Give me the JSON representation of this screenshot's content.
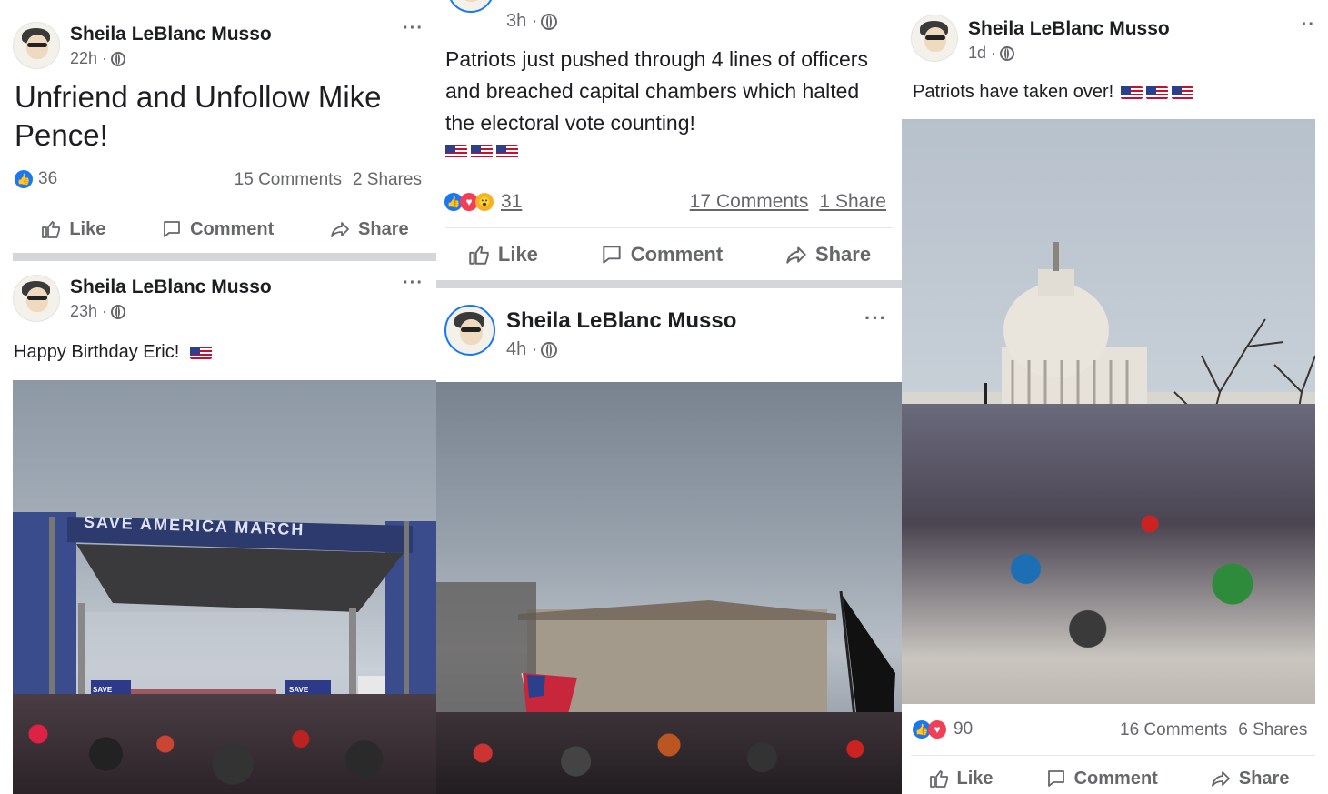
{
  "colors": {
    "accent": "#1877f2",
    "secondary_text": "#65676b",
    "separator": "#d4d6da",
    "love": "#f33e58",
    "wow": "#f7b125"
  },
  "icons": [
    "avatar",
    "globe-icon",
    "more-icon",
    "like-reaction-icon",
    "love-reaction-icon",
    "wow-reaction-icon",
    "thumbs-up-icon",
    "comment-icon",
    "share-icon",
    "us-flag-emoji"
  ],
  "post1": {
    "author": "Sheila LeBlanc Musso",
    "time": "22h ·",
    "more": "···",
    "text": "Unfriend and Unfollow Mike Pence!",
    "reaction_count": "36",
    "comments": "15 Comments",
    "shares": "2 Shares",
    "actions": {
      "like": "Like",
      "comment": "Comment",
      "share": "Share"
    }
  },
  "post2": {
    "author": "Sheila LeBlanc Musso",
    "time": "23h ·",
    "more": "···",
    "text": "Happy Birthday Eric!",
    "image_banner": "SAVE AMERICA MARCH",
    "sign_left": "SAVE AMERICA",
    "sign_right": "SAVE AMERICA MARCH"
  },
  "post3": {
    "time": "3h ·",
    "text": "Patriots just pushed through 4 lines of officers and breached capital chambers which halted the electoral vote counting!",
    "reaction_count": "31",
    "comments": "17 Comments",
    "shares": "1 Share",
    "actions": {
      "like": "Like",
      "comment": "Comment",
      "share": "Share"
    }
  },
  "post4": {
    "author": "Sheila LeBlanc Musso",
    "time": "4h ·",
    "more": "···"
  },
  "post5": {
    "author": "Sheila LeBlanc Musso",
    "time": "1d ·",
    "more": "··",
    "text": "Patriots have taken over!",
    "reaction_count": "90",
    "comments": "16 Comments",
    "shares": "6 Shares",
    "actions": {
      "like": "Like",
      "comment": "Comment",
      "share": "Share"
    }
  }
}
